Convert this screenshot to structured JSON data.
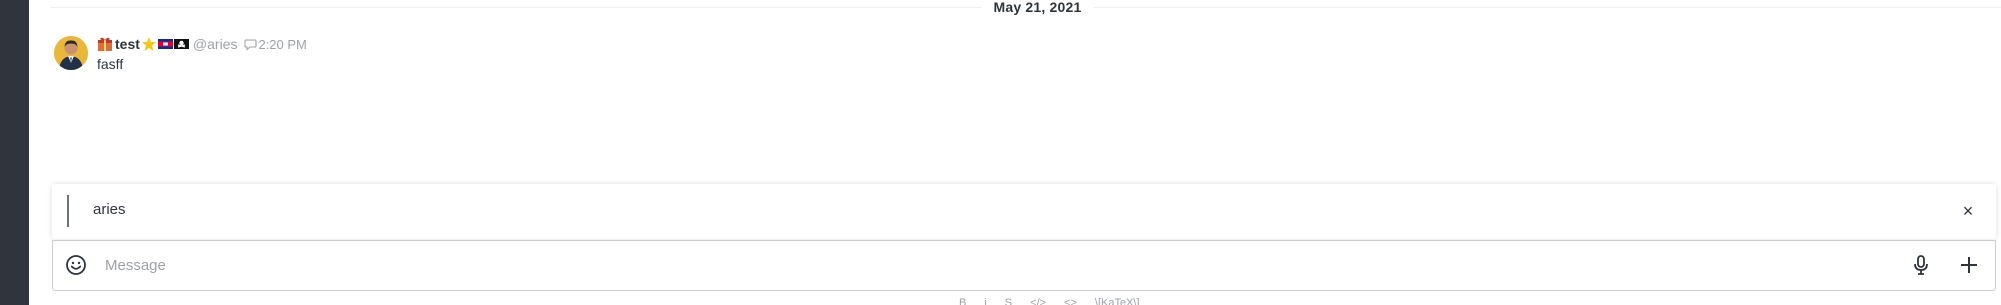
{
  "date_divider": {
    "label": "May 21, 2021"
  },
  "message": {
    "username": "test",
    "handle": "@aries",
    "time": "2:20 PM",
    "body": "fasff",
    "emoji_icons": [
      "gift-emoji-icon",
      "star-emoji-icon",
      "flag-cambodia-icon",
      "flag-pirate-icon"
    ]
  },
  "reply_preview": {
    "quoted_user": "aries",
    "close_glyph": "×"
  },
  "composer": {
    "placeholder": "Message",
    "value": ""
  },
  "format_toolbar": {
    "items": [
      "B",
      "i",
      "S",
      "</>",
      "<> ",
      "\\[KaTeX\\]"
    ]
  },
  "colors": {
    "sidebar": "#2f343d",
    "text": "#2f343d",
    "muted": "#9ea2a8",
    "border": "#cbced1"
  }
}
